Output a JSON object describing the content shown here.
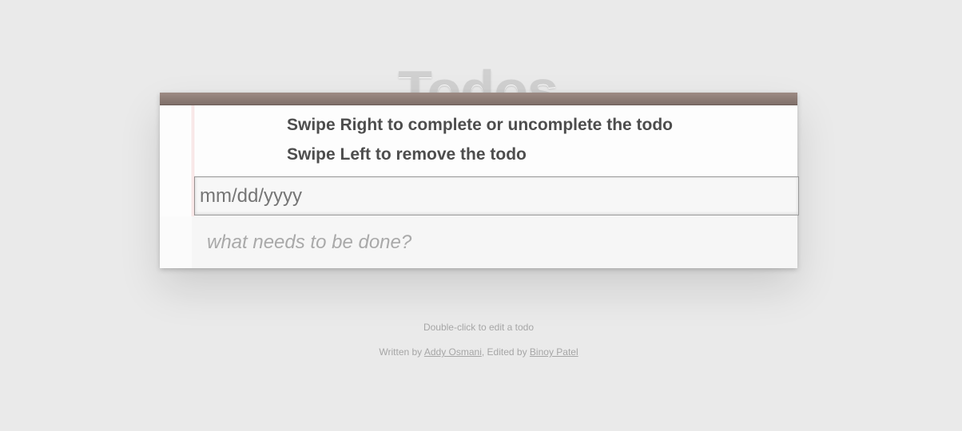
{
  "app": {
    "title": "Todos"
  },
  "instructions": {
    "swipe_right": "Swipe Right to complete or uncomplete the todo",
    "swipe_left": "Swipe Left to remove the todo"
  },
  "date_field": {
    "placeholder": "mm/dd/yyyy",
    "value": ""
  },
  "new_todo": {
    "placeholder": "what needs to be done?",
    "value": ""
  },
  "footer": {
    "hint": "Double-click to edit a todo",
    "written_by_prefix": "Written by ",
    "author_1": "Addy Osmani",
    "separator": ", Edited by ",
    "author_2": "Binoy Patel"
  },
  "colors": {
    "background": "#eaeaea",
    "header_bar": "#8f7d77",
    "title": "#d0d0d0",
    "text": "#4d4d4d",
    "margin_line": "#f5d6d6"
  }
}
